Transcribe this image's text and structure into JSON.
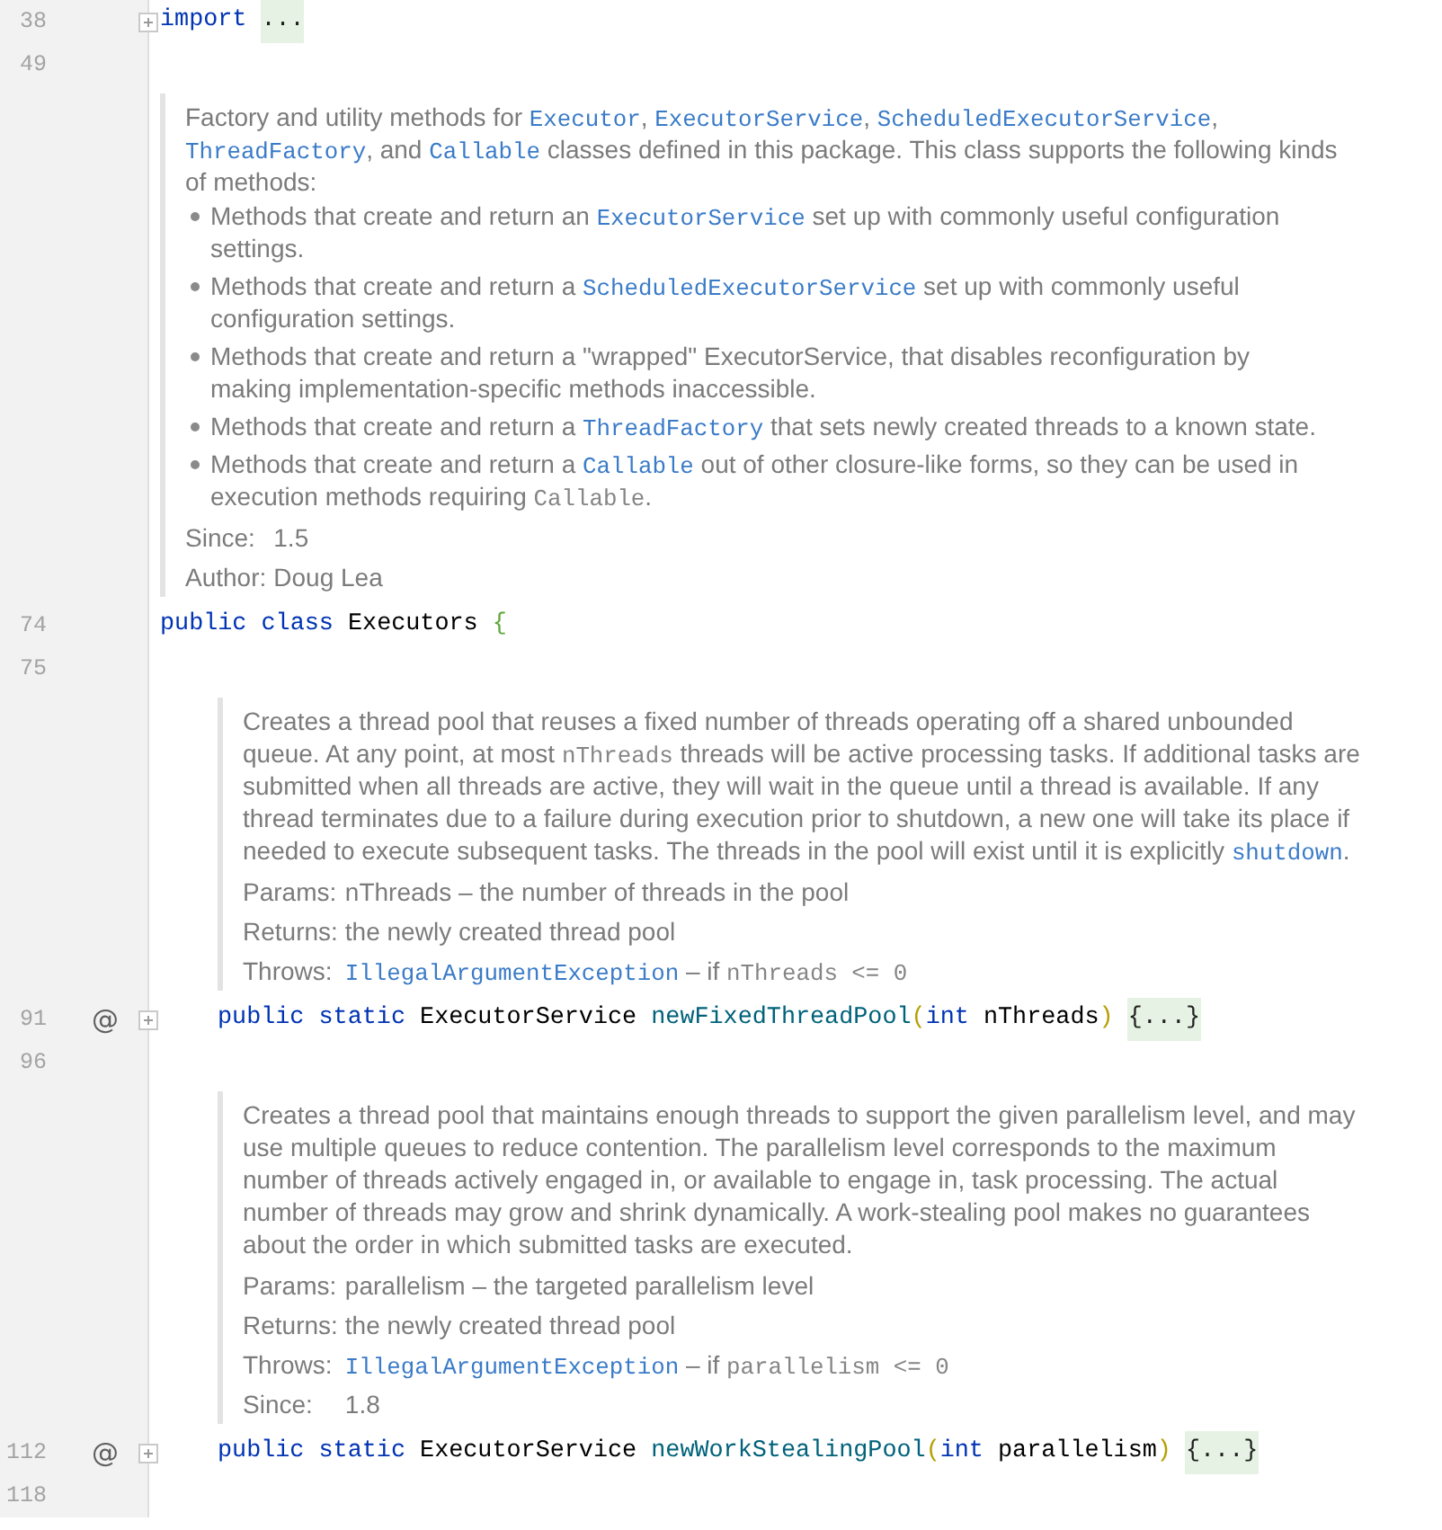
{
  "editor": {
    "lines": [
      {
        "kind": "code",
        "number": "38",
        "collapsed": true,
        "words": [
          [
            {
              "text": "import",
              "kind": "keyword"
            }
          ]
        ],
        "placeholder": "..."
      },
      {
        "kind": "blank",
        "number": "49"
      },
      {
        "kind": "doc",
        "body": [
          {
            "kind": "paragraph",
            "segments": [
              {
                "text": "Factory and utility methods for ",
                "kind": "text"
              },
              {
                "text": "Executor",
                "kind": "link"
              },
              {
                "text": ", ",
                "kind": "text"
              },
              {
                "text": "ExecutorService",
                "kind": "link"
              },
              {
                "text": ", ",
                "kind": "text"
              },
              {
                "text": "ScheduledExecutorService",
                "kind": "link"
              },
              {
                "text": ", ",
                "kind": "text"
              },
              {
                "text": "ThreadFactory",
                "kind": "link"
              },
              {
                "text": ", and ",
                "kind": "text"
              },
              {
                "text": "Callable",
                "kind": "link"
              },
              {
                "text": " classes defined in this package. This class supports the following kinds of methods:",
                "kind": "text"
              }
            ]
          },
          {
            "kind": "list",
            "items": [
              {
                "segments": [
                  {
                    "text": "Methods that create and return an ",
                    "kind": "text"
                  },
                  {
                    "text": "ExecutorService",
                    "kind": "link"
                  },
                  {
                    "text": " set up with commonly useful configuration settings.",
                    "kind": "text"
                  }
                ]
              },
              {
                "segments": [
                  {
                    "text": "Methods that create and return a ",
                    "kind": "text"
                  },
                  {
                    "text": "ScheduledExecutorService",
                    "kind": "link"
                  },
                  {
                    "text": " set up with commonly useful configuration settings.",
                    "kind": "text"
                  }
                ]
              },
              {
                "segments": [
                  {
                    "text": "Methods that create and return a \"wrapped\" ExecutorService, that disables reconfiguration by making implementation-specific methods inaccessible.",
                    "kind": "text"
                  }
                ]
              },
              {
                "segments": [
                  {
                    "text": "Methods that create and return a ",
                    "kind": "text"
                  },
                  {
                    "text": "ThreadFactory",
                    "kind": "link"
                  },
                  {
                    "text": " that sets newly created threads to a known state.",
                    "kind": "text"
                  }
                ]
              },
              {
                "segments": [
                  {
                    "text": "Methods that create and return a ",
                    "kind": "text"
                  },
                  {
                    "text": "Callable",
                    "kind": "link"
                  },
                  {
                    "text": " out of other closure-like forms, so they can be used in execution methods requiring ",
                    "kind": "text"
                  },
                  {
                    "text": "Callable",
                    "kind": "code"
                  },
                  {
                    "text": ".",
                    "kind": "text"
                  }
                ]
              }
            ]
          }
        ],
        "tags": [
          {
            "label": "Since:",
            "value": [
              {
                "text": "1.5",
                "kind": "text"
              }
            ]
          },
          {
            "label": "Author:",
            "value": [
              {
                "text": "Doug Lea",
                "kind": "text"
              }
            ]
          }
        ]
      },
      {
        "kind": "code",
        "number": "74",
        "words": [
          [
            {
              "text": "public",
              "kind": "keyword"
            }
          ],
          [
            {
              "text": "class",
              "kind": "keyword"
            }
          ],
          [
            {
              "text": "Executors",
              "kind": "type"
            }
          ],
          [
            {
              "text": "{",
              "kind": "brace"
            }
          ]
        ],
        "children": [
          {
            "kind": "blank",
            "number": "75"
          },
          {
            "kind": "doc",
            "body": [
              {
                "kind": "paragraph",
                "segments": [
                  {
                    "text": "Creates a thread pool that reuses a fixed number of threads operating off a shared unbounded queue. At any point, at most ",
                    "kind": "text"
                  },
                  {
                    "text": "nThreads",
                    "kind": "code"
                  },
                  {
                    "text": " threads will be active processing tasks. If additional tasks are submitted when all threads are active, they will wait in the queue until a thread is available. If any thread terminates due to a failure during execution prior to shutdown, a new one will take its place if needed to execute subsequent tasks. The threads in the pool will exist until it is explicitly ",
                    "kind": "text"
                  },
                  {
                    "text": "shutdown",
                    "kind": "link"
                  },
                  {
                    "text": ".",
                    "kind": "text"
                  }
                ]
              }
            ],
            "tags": [
              {
                "label": "Params:",
                "value": [
                  {
                    "text": "nThreads – the number of threads in the pool",
                    "kind": "text"
                  }
                ]
              },
              {
                "label": "Returns:",
                "value": [
                  {
                    "text": "the newly created thread pool",
                    "kind": "text"
                  }
                ]
              },
              {
                "label": "Throws:",
                "value": [
                  {
                    "text": "IllegalArgumentException",
                    "kind": "link"
                  },
                  {
                    "text": " – if ",
                    "kind": "text"
                  },
                  {
                    "text": "nThreads <= 0",
                    "kind": "code"
                  }
                ]
              }
            ]
          },
          {
            "kind": "code",
            "number": "91",
            "gutter_mark": "@",
            "collapsed": true,
            "words": [
              [
                {
                  "text": "public",
                  "kind": "keyword"
                }
              ],
              [
                {
                  "text": "static",
                  "kind": "keyword"
                }
              ],
              [
                {
                  "text": "ExecutorService",
                  "kind": "type"
                }
              ],
              [
                {
                  "text": "newFixedThreadPool",
                  "kind": "method"
                },
                {
                  "text": "(",
                  "kind": "paren"
                },
                {
                  "text": "int",
                  "kind": "keyword"
                }
              ],
              [
                {
                  "text": "nThreads",
                  "kind": "param"
                },
                {
                  "text": ")",
                  "kind": "paren"
                }
              ]
            ],
            "placeholder": "{...}"
          },
          {
            "kind": "blank",
            "number": "96"
          },
          {
            "kind": "doc",
            "body": [
              {
                "kind": "paragraph",
                "segments": [
                  {
                    "text": "Creates a thread pool that maintains enough threads to support the given parallelism level, and may use multiple queues to reduce contention. The parallelism level corresponds to the maximum number of threads actively engaged in, or available to engage in, task processing. The actual number of threads may grow and shrink dynamically. A work-stealing pool makes no guarantees about the order in which submitted tasks are executed.",
                    "kind": "text"
                  }
                ]
              }
            ],
            "tags": [
              {
                "label": "Params:",
                "value": [
                  {
                    "text": "parallelism – the targeted parallelism level",
                    "kind": "text"
                  }
                ]
              },
              {
                "label": "Returns:",
                "value": [
                  {
                    "text": "the newly created thread pool",
                    "kind": "text"
                  }
                ]
              },
              {
                "label": "Throws:",
                "value": [
                  {
                    "text": "IllegalArgumentException",
                    "kind": "link"
                  },
                  {
                    "text": " – if ",
                    "kind": "text"
                  },
                  {
                    "text": "parallelism <= 0",
                    "kind": "code"
                  }
                ]
              },
              {
                "label": "Since:",
                "value": [
                  {
                    "text": "1.8",
                    "kind": "text"
                  }
                ]
              }
            ]
          },
          {
            "kind": "code",
            "number": "112",
            "gutter_mark": "@",
            "collapsed": true,
            "words": [
              [
                {
                  "text": "public",
                  "kind": "keyword"
                }
              ],
              [
                {
                  "text": "static",
                  "kind": "keyword"
                }
              ],
              [
                {
                  "text": "ExecutorService",
                  "kind": "type"
                }
              ],
              [
                {
                  "text": "newWorkStealingPool",
                  "kind": "method"
                },
                {
                  "text": "(",
                  "kind": "paren"
                },
                {
                  "text": "int",
                  "kind": "keyword"
                }
              ],
              [
                {
                  "text": "parallelism",
                  "kind": "param"
                },
                {
                  "text": ")",
                  "kind": "paren"
                }
              ]
            ],
            "placeholder": "{...}"
          },
          {
            "kind": "blank",
            "number": "118"
          }
        ]
      }
    ]
  }
}
